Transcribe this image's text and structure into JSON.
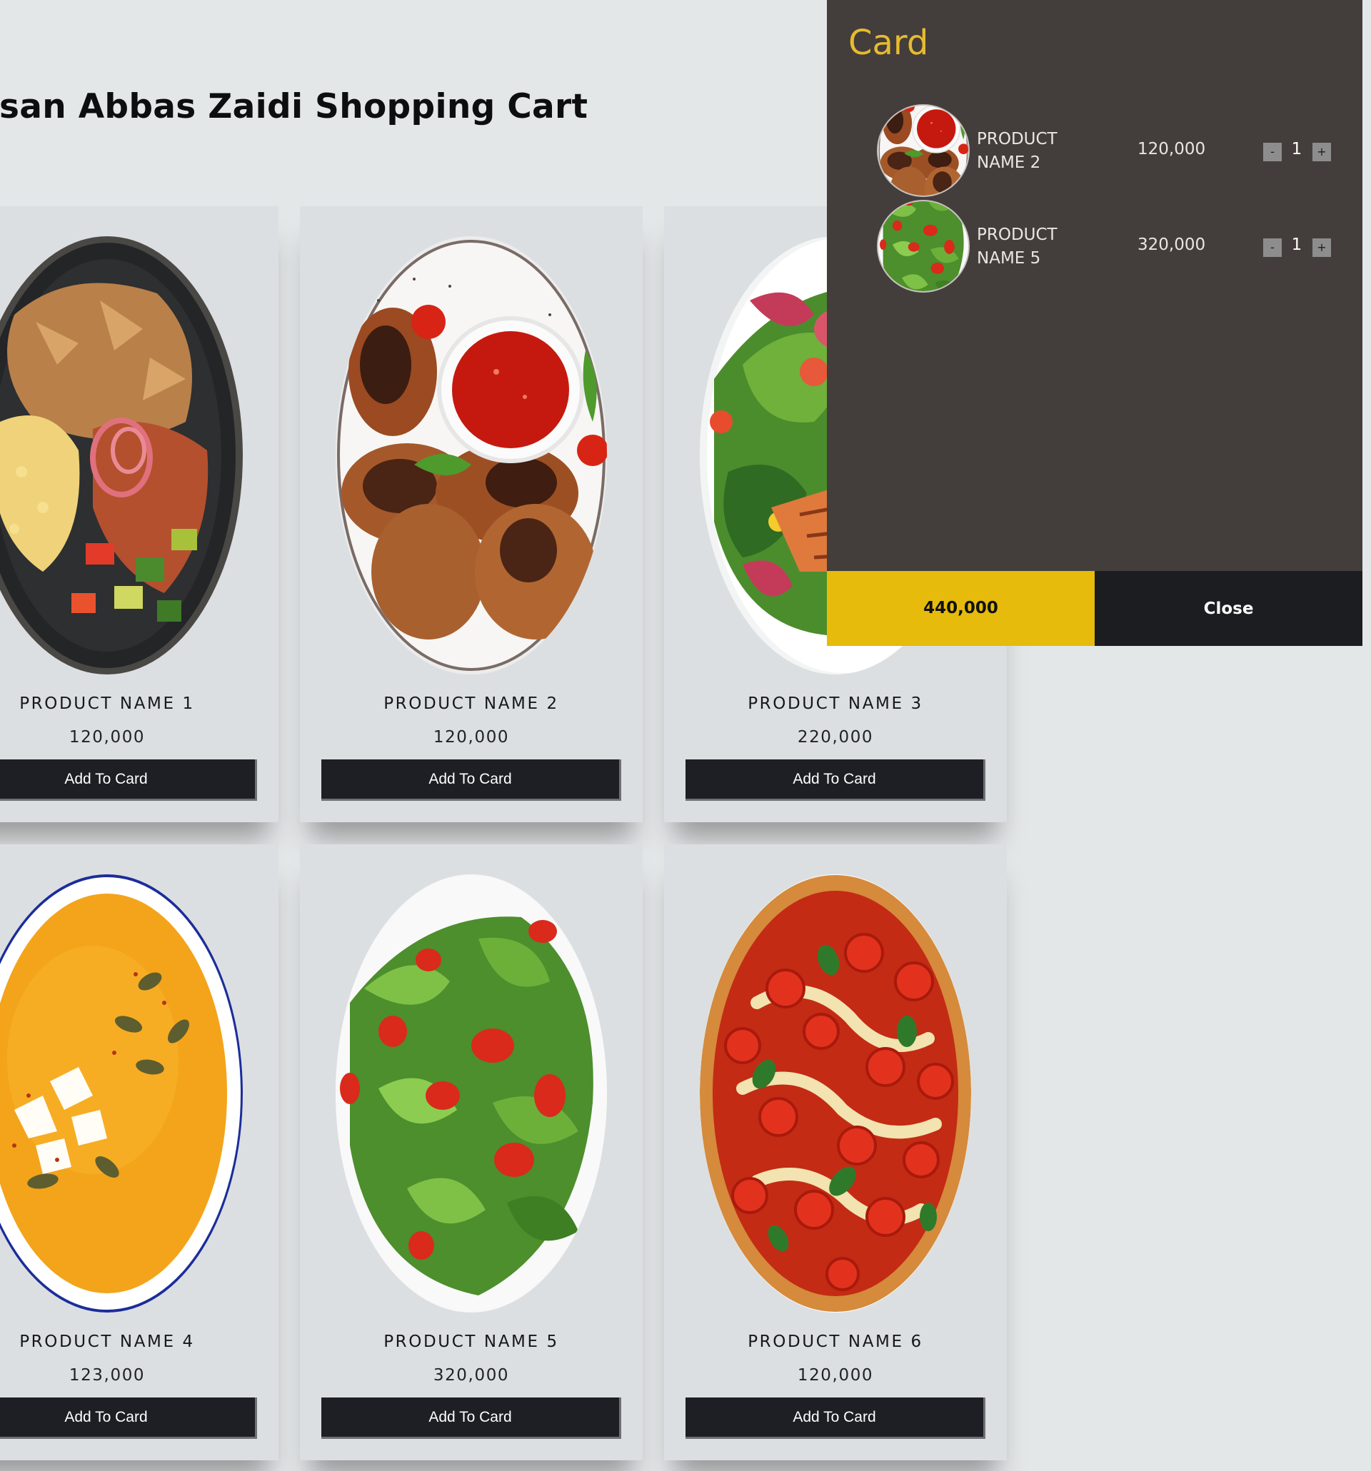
{
  "header": {
    "title": "san Abbas Zaidi Shopping Cart"
  },
  "products": [
    {
      "name": "PRODUCT NAME 1",
      "price": "120,000",
      "button": "Add To Card"
    },
    {
      "name": "PRODUCT NAME 2",
      "price": "120,000",
      "button": "Add To Card"
    },
    {
      "name": "PRODUCT NAME 3",
      "price": "220,000",
      "button": "Add To Card"
    },
    {
      "name": "PRODUCT NAME 4",
      "price": "123,000",
      "button": "Add To Card"
    },
    {
      "name": "PRODUCT NAME 5",
      "price": "320,000",
      "button": "Add To Card"
    },
    {
      "name": "PRODUCT NAME 6",
      "price": "120,000",
      "button": "Add To Card"
    }
  ],
  "cart": {
    "title": "Card",
    "items": [
      {
        "name": "PRODUCT NAME 2",
        "price": "120,000",
        "quantity": "1",
        "minus": "-",
        "plus": "+"
      },
      {
        "name": "PRODUCT NAME 5",
        "price": "320,000",
        "quantity": "1",
        "minus": "-",
        "plus": "+"
      }
    ],
    "total": "440,000",
    "close_label": "Close"
  },
  "colors": {
    "page_background": "#e4e7e8",
    "card_background": "#dcdfe1",
    "button_background": "#1d1f24",
    "cart_background": "#433d3b",
    "cart_title": "#e6bb2f",
    "total_background": "#e6bb0b",
    "close_background": "#1b1d21"
  }
}
